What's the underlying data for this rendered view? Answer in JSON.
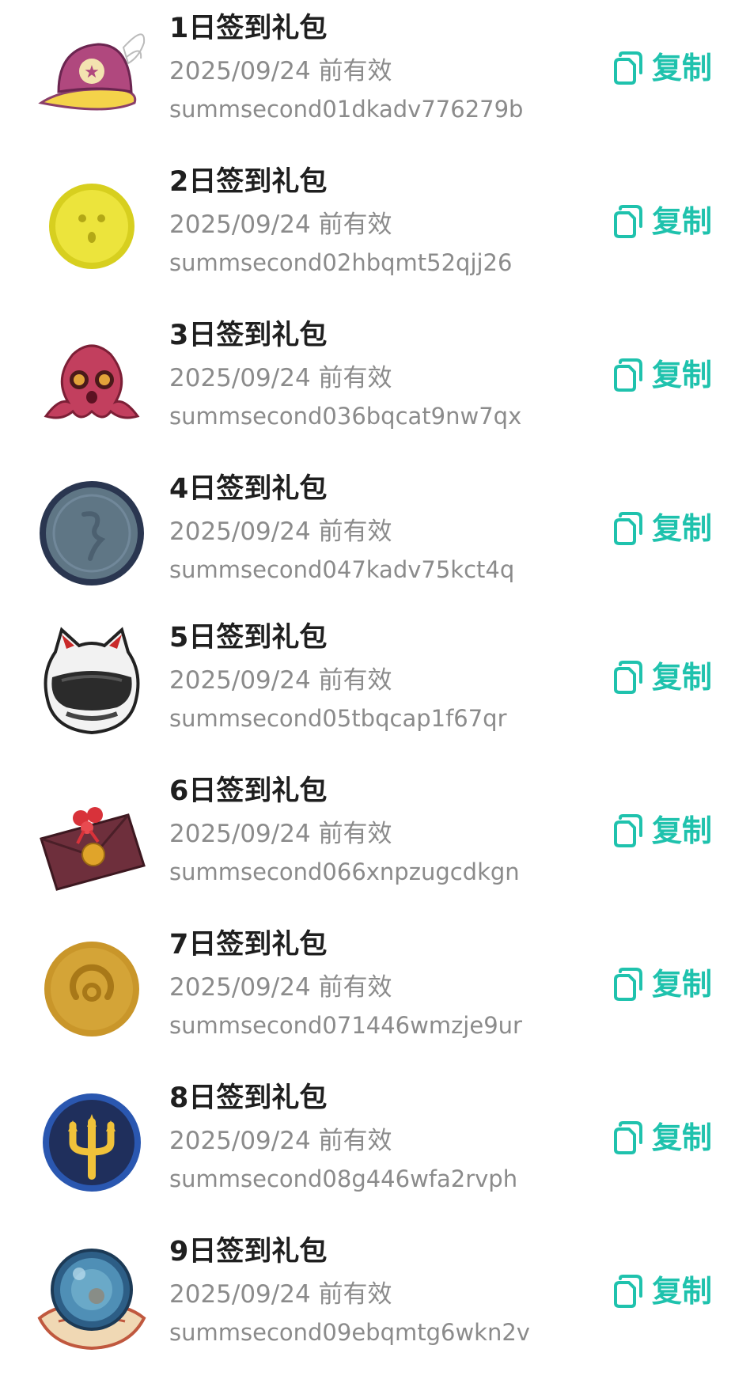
{
  "accent_color": "#1fc2ad",
  "gifts": [
    {
      "icon": "winged-cap-icon",
      "title": "1日签到礼包",
      "expiry": "2025/09/24 前有效",
      "code": "summsecond01dkadv776279b",
      "copy_label": "复制"
    },
    {
      "icon": "yellow-face-coin-icon",
      "title": "2日签到礼包",
      "expiry": "2025/09/24 前有效",
      "code": "summsecond02hbqmt52qjj26",
      "copy_label": "复制"
    },
    {
      "icon": "octopus-icon",
      "title": "3日签到礼包",
      "expiry": "2025/09/24 前有效",
      "code": "summsecond036bqcat9nw7qx",
      "copy_label": "复制"
    },
    {
      "icon": "slate-coin-icon",
      "title": "4日签到礼包",
      "expiry": "2025/09/24 前有效",
      "code": "summsecond047kadv75kct4q",
      "copy_label": "复制"
    },
    {
      "icon": "cat-helmet-icon",
      "title": "5日签到礼包",
      "expiry": "2025/09/24 前有效",
      "code": "summsecond05tbqcap1f67qr",
      "copy_label": "复制"
    },
    {
      "icon": "envelope-icon",
      "title": "6日签到礼包",
      "expiry": "2025/09/24 前有效",
      "code": "summsecond066xnpzugcdkgn",
      "copy_label": "复制"
    },
    {
      "icon": "gold-coin-icon",
      "title": "7日签到礼包",
      "expiry": "2025/09/24 前有效",
      "code": "summsecond071446wmzje9ur",
      "copy_label": "复制"
    },
    {
      "icon": "trident-coin-icon",
      "title": "8日签到礼包",
      "expiry": "2025/09/24 前有效",
      "code": "summsecond08g446wfa2rvph",
      "copy_label": "复制"
    },
    {
      "icon": "crystal-ball-icon",
      "title": "9日签到礼包",
      "expiry": "2025/09/24 前有效",
      "code": "summsecond09ebqmtg6wkn2v",
      "copy_label": "复制"
    }
  ]
}
